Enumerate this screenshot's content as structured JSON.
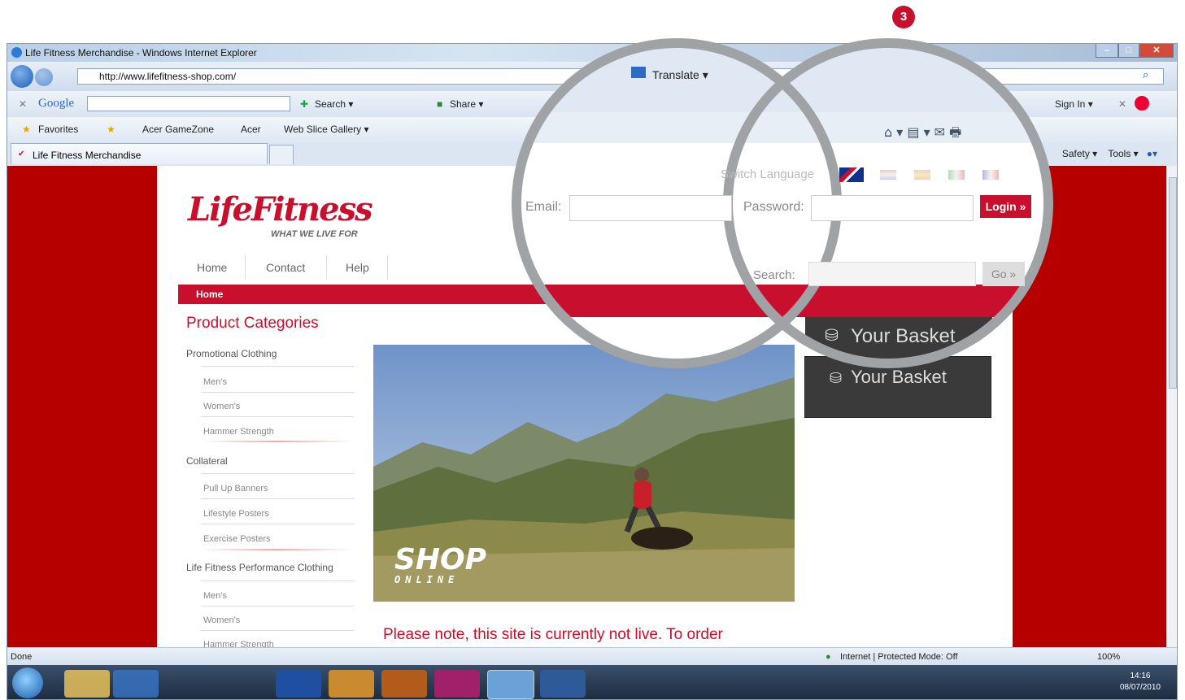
{
  "step_badge": "3",
  "window": {
    "title": "Life Fitness Merchandise - Windows Internet Explorer",
    "address": "http://www.lifefitness-shop.com/"
  },
  "google_toolbar": {
    "brand": "Google",
    "search": "Search ▾",
    "share": "Share ▾",
    "sign_in": "Sign In ▾"
  },
  "favorites_bar": {
    "favorites": "Favorites",
    "items": [
      "Acer GameZone",
      "Acer",
      "Web Slice Gallery ▾"
    ]
  },
  "tab": {
    "label": "Life Fitness Merchandise"
  },
  "command_bar": {
    "translate": "Translate ▾",
    "safety": "Safety ▾",
    "tools": "Tools ▾"
  },
  "site": {
    "logo": "LifeFitness",
    "tagline": "WHAT WE LIVE FOR",
    "menu": [
      "Home",
      "Contact",
      "Help"
    ],
    "breadcrumb": "Home",
    "switch_language": "Switch Language",
    "email_label": "Email:",
    "password_label": "Password:",
    "login_button": "Login »",
    "search_label": "Search:",
    "go_button": "Go »",
    "basket": "Your Basket",
    "categories_title": "Product Categories",
    "categories": [
      {
        "name": "Promotional Clothing",
        "items": [
          "Men's",
          "Women's",
          "Hammer Strength"
        ]
      },
      {
        "name": "Collateral",
        "items": [
          "Pull Up Banners",
          "Lifestyle Posters",
          "Exercise Posters"
        ]
      },
      {
        "name": "Life Fitness Performance Clothing",
        "items": [
          "Men's",
          "Women's",
          "Hammer Strength"
        ]
      }
    ],
    "hero_title": "SHOP",
    "hero_sub": "ONLINE",
    "notice": "Please note, this site is currently not live. To order merchandise please contact your local sales office.",
    "notice_dots": "· · ·"
  },
  "status_bar": {
    "done": "Done",
    "zone": "Internet | Protected Mode: Off",
    "zoom": "100%"
  },
  "taskbar": {
    "time": "14:16",
    "date": "08/07/2010"
  },
  "colors": {
    "brand_red": "#c8102e",
    "page_bg_red": "#b60000"
  }
}
